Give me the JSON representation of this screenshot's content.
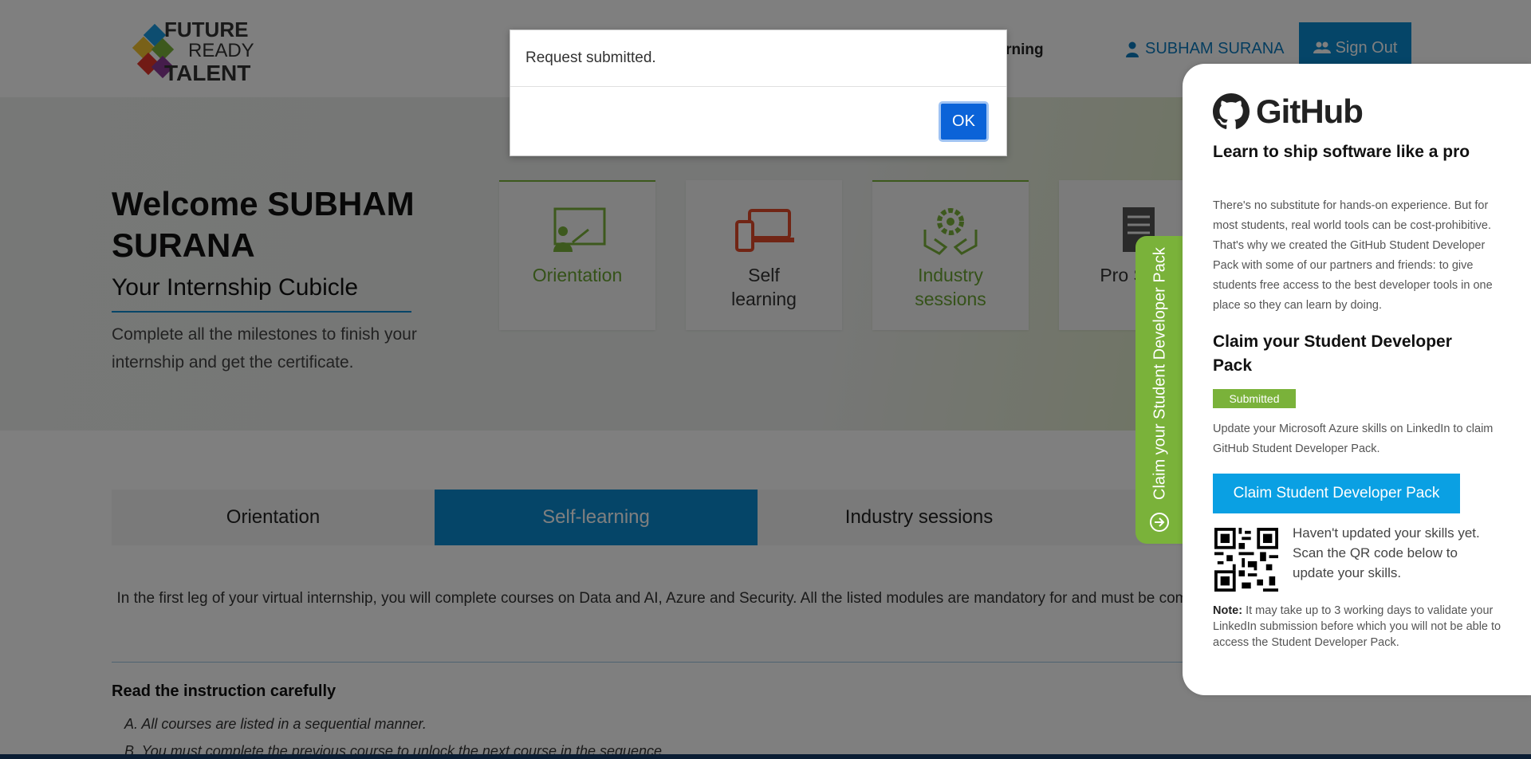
{
  "header": {
    "logo_words": [
      "FUTURE",
      "READY",
      "TALENT"
    ],
    "nav_partial": "earning",
    "user_name": "SUBHAM SURANA",
    "sign_out": "Sign Out"
  },
  "hero": {
    "welcome": "Welcome SUBHAM SURANA",
    "subtitle": "Your Internship Cubicle",
    "description": "Complete all the milestones to finish your internship and get the certificate."
  },
  "milestones": [
    {
      "label": "Orientation",
      "icon": "presentation-icon"
    },
    {
      "label": "Self learning",
      "icon": "devices-icon"
    },
    {
      "label": "Industry sessions",
      "icon": "gear-hands-icon"
    },
    {
      "label": "Pro Sync",
      "icon": "document-icon"
    }
  ],
  "tabs": [
    "Orientation",
    "Self-learning",
    "Industry sessions"
  ],
  "intro": "In the first leg of your virtual internship, you will complete courses on Data and AI, Azure and Security. All the listed modules are mandatory for and must be completed within the specified time.",
  "instructions": {
    "title": "Read the instruction carefully",
    "rules": [
      "A. All courses are listed in a sequential manner.",
      "B. You must complete the previous course to unlock the next course in the sequence."
    ]
  },
  "side_tab": {
    "label": "Claim your Student Developer Pack"
  },
  "github_panel": {
    "brand": "GitHub",
    "heading": "Learn to ship software like a pro",
    "body": "There's no substitute for hands-on experience. But for most students, real world tools can be cost-prohibitive. That's why we created the GitHub Student Developer Pack with some of our partners and friends: to give students free access to the best developer tools in one place so they can learn by doing.",
    "claim_heading": "Claim your Student Developer Pack",
    "status_badge": "Submitted",
    "update_text": "Update your Microsoft Azure skills on LinkedIn to claim GitHub Student Developer Pack.",
    "claim_button": "Claim Student Developer Pack",
    "qr_text": "Haven't updated your skills yet. Scan the QR code below to update your skills.",
    "note_label": "Note:",
    "note_text": " It may take up to 3 working days to validate your LinkedIn submission before which you will not be able to access the Student Developer Pack."
  },
  "dialog": {
    "message": "Request submitted.",
    "ok": "OK"
  },
  "colors": {
    "primary_blue": "#0a8ad0",
    "green": "#7ab23a",
    "dialog_button": "#0b63d8",
    "claim_button": "#0aa0e3"
  }
}
